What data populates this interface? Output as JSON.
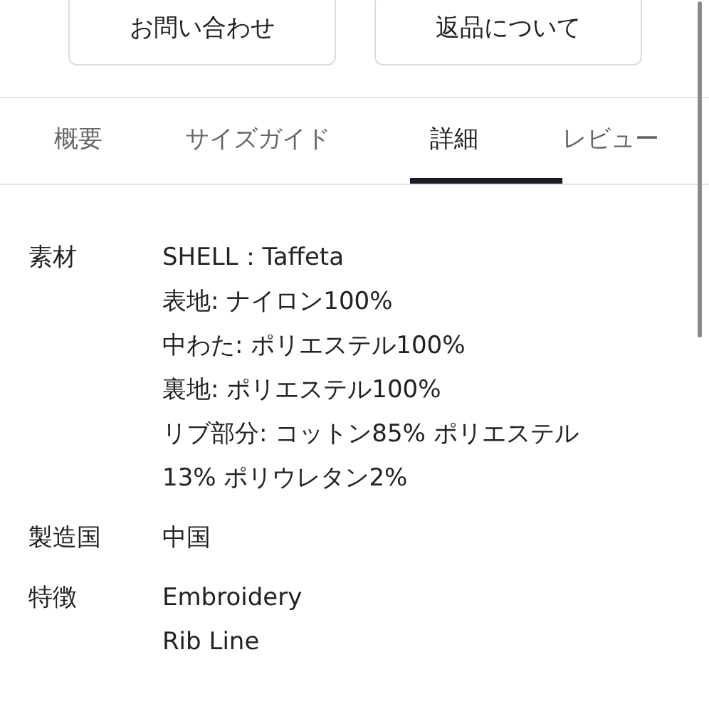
{
  "buttons": [
    "お問い合わせ",
    "返品について"
  ],
  "tabs": [
    {
      "label": "概要",
      "selected": false
    },
    {
      "label": "サイズガイド",
      "selected": false
    },
    {
      "label": "詳細",
      "selected": true
    },
    {
      "label": "レビュー",
      "selected": false
    }
  ],
  "details": [
    {
      "label": "素材",
      "values": [
        "SHELL：Taffeta",
        "表地: ナイロン100%",
        "中わた: ポリエステル100%",
        "裏地: ポリエステル100%",
        "リブ部分: コットン85% ポリエステル 13% ポリウレタン2%"
      ]
    },
    {
      "label": "製造国",
      "values": [
        "中国"
      ]
    },
    {
      "label": "特徴",
      "values": [
        "Embroidery",
        "Rib Line"
      ]
    }
  ]
}
